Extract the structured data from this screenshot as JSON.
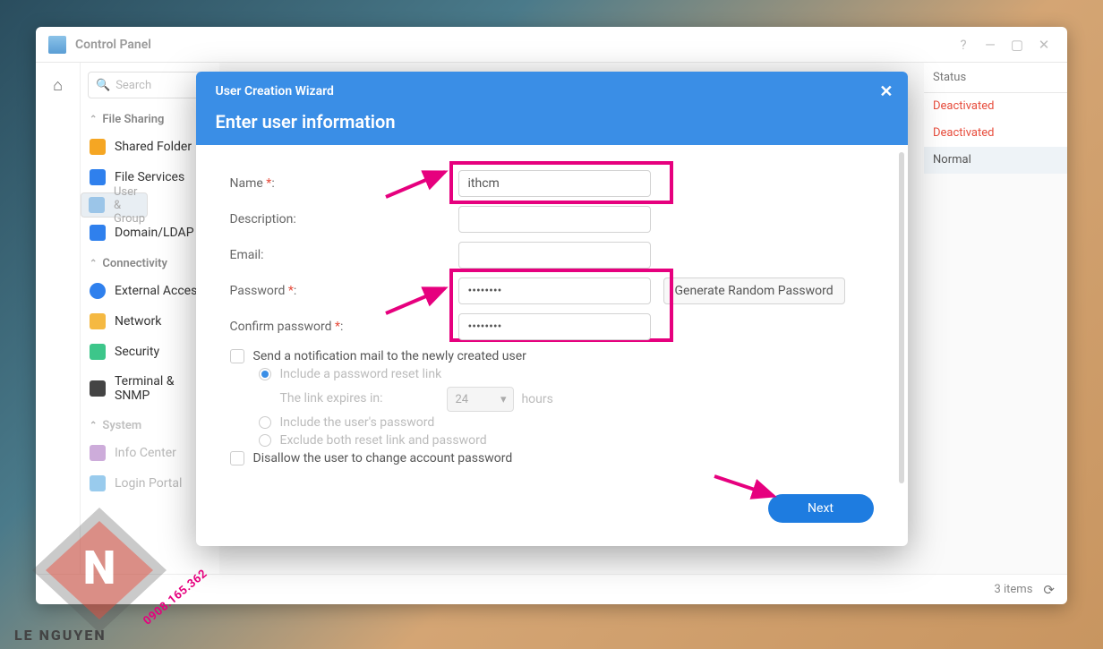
{
  "window": {
    "title": "Control Panel",
    "help": "?",
    "min": "—",
    "max": "▢",
    "close": "✕"
  },
  "search": {
    "placeholder": "Search",
    "icon": "🔍"
  },
  "sidebar": {
    "sections": [
      {
        "label": "File Sharing",
        "items": [
          {
            "label": "Shared Folder"
          },
          {
            "label": "File Services"
          },
          {
            "label": "User & Group"
          },
          {
            "label": "Domain/LDAP"
          }
        ]
      },
      {
        "label": "Connectivity",
        "items": [
          {
            "label": "External Access"
          },
          {
            "label": "Network"
          },
          {
            "label": "Security"
          },
          {
            "label": "Terminal & SNMP"
          }
        ]
      },
      {
        "label": "System",
        "items": [
          {
            "label": "Info Center"
          },
          {
            "label": "Login Portal"
          }
        ]
      }
    ]
  },
  "statusColumn": {
    "header": "Status",
    "rows": [
      "Deactivated",
      "Deactivated",
      "Normal"
    ]
  },
  "footer": {
    "count": "3 items"
  },
  "modal": {
    "title": "User Creation Wizard",
    "subtitle": "Enter user information",
    "fields": {
      "name": {
        "label": "Name",
        "required": "*",
        "value": "ithcm"
      },
      "desc": {
        "label": "Description:",
        "value": ""
      },
      "email": {
        "label": "Email:",
        "value": ""
      },
      "pw": {
        "label": "Password",
        "required": "*",
        "value": "••••••••"
      },
      "cpw": {
        "label": "Confirm password",
        "required": "*",
        "value": "••••••••"
      },
      "gen": "Generate Random Password"
    },
    "opts": {
      "sendMail": "Send a notification mail to the newly created user",
      "inclReset": "Include a password reset link",
      "expiresLabel": "The link expires in:",
      "expiresVal": "24",
      "expiresUnit": "hours",
      "inclPw": "Include the user's password",
      "exclBoth": "Exclude both reset link and password",
      "disallow": "Disallow the user to change account password"
    },
    "next": "Next"
  },
  "watermark": {
    "brand": "LE NGUYEN",
    "phone": "0908.165.362"
  }
}
